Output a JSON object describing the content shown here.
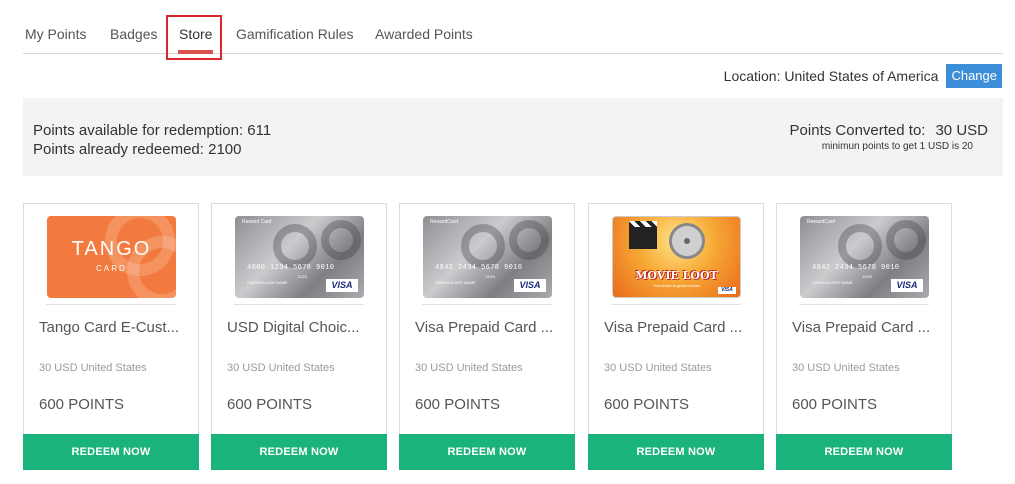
{
  "tabs": [
    {
      "label": "My Points"
    },
    {
      "label": "Badges"
    },
    {
      "label": "Store",
      "active": true
    },
    {
      "label": "Gamification Rules"
    },
    {
      "label": "Awarded Points"
    }
  ],
  "location": {
    "label": "Location: United States of America",
    "change_label": "Change"
  },
  "summary": {
    "available": "Points available for redemption: 611",
    "redeemed": "Points already redeemed: 2100",
    "converted_label": "Points Converted to:",
    "converted_value": "30 USD",
    "note": "minimun points to get 1 USD is 20"
  },
  "cards": [
    {
      "title": "Tango Card E-Cust...",
      "sub": "30 USD United States",
      "points": "600 POINTS",
      "redeem": "REDEEM NOW",
      "art": {
        "brand": "TANGO",
        "brand_sub": "CARD"
      }
    },
    {
      "title": "USD Digital Choic...",
      "sub": "30 USD United States",
      "points": "600 POINTS",
      "redeem": "REDEEM NOW",
      "art": {
        "header": "Reward Card",
        "number": "4000 1234 5678 9010",
        "expiry": "12/20",
        "holder": "CARDHOLDER NAME",
        "logo": "VISA"
      }
    },
    {
      "title": "Visa Prepaid Card ...",
      "sub": "30 USD United States",
      "points": "600 POINTS",
      "redeem": "REDEEM NOW",
      "art": {
        "header": "RewardCard",
        "number": "4842 2434 5678 9010",
        "expiry": "12/20",
        "holder": "CARDHOLDER NAME",
        "logo": "VISA"
      }
    },
    {
      "title": "Visa Prepaid Card ...",
      "sub": "30 USD United States",
      "points": "600 POINTS",
      "redeem": "REDEEM NOW",
      "art": {
        "title": "MOVIE LOOT",
        "tagline": "Your ticket to great movies",
        "logo": "VISA"
      }
    },
    {
      "title": "Visa Prepaid Card ...",
      "sub": "30 USD United States",
      "points": "600 POINTS",
      "redeem": "REDEEM NOW",
      "art": {
        "header": "RewardCard",
        "number": "4842 2434 5678 9010",
        "expiry": "12/20",
        "holder": "CARDHOLDER NAME",
        "logo": "VISA"
      }
    }
  ],
  "colors": {
    "accent": "#3b8ed7",
    "redeem": "#1ab37b",
    "tango": "#f27a3e",
    "highlight": "#d9262b"
  }
}
